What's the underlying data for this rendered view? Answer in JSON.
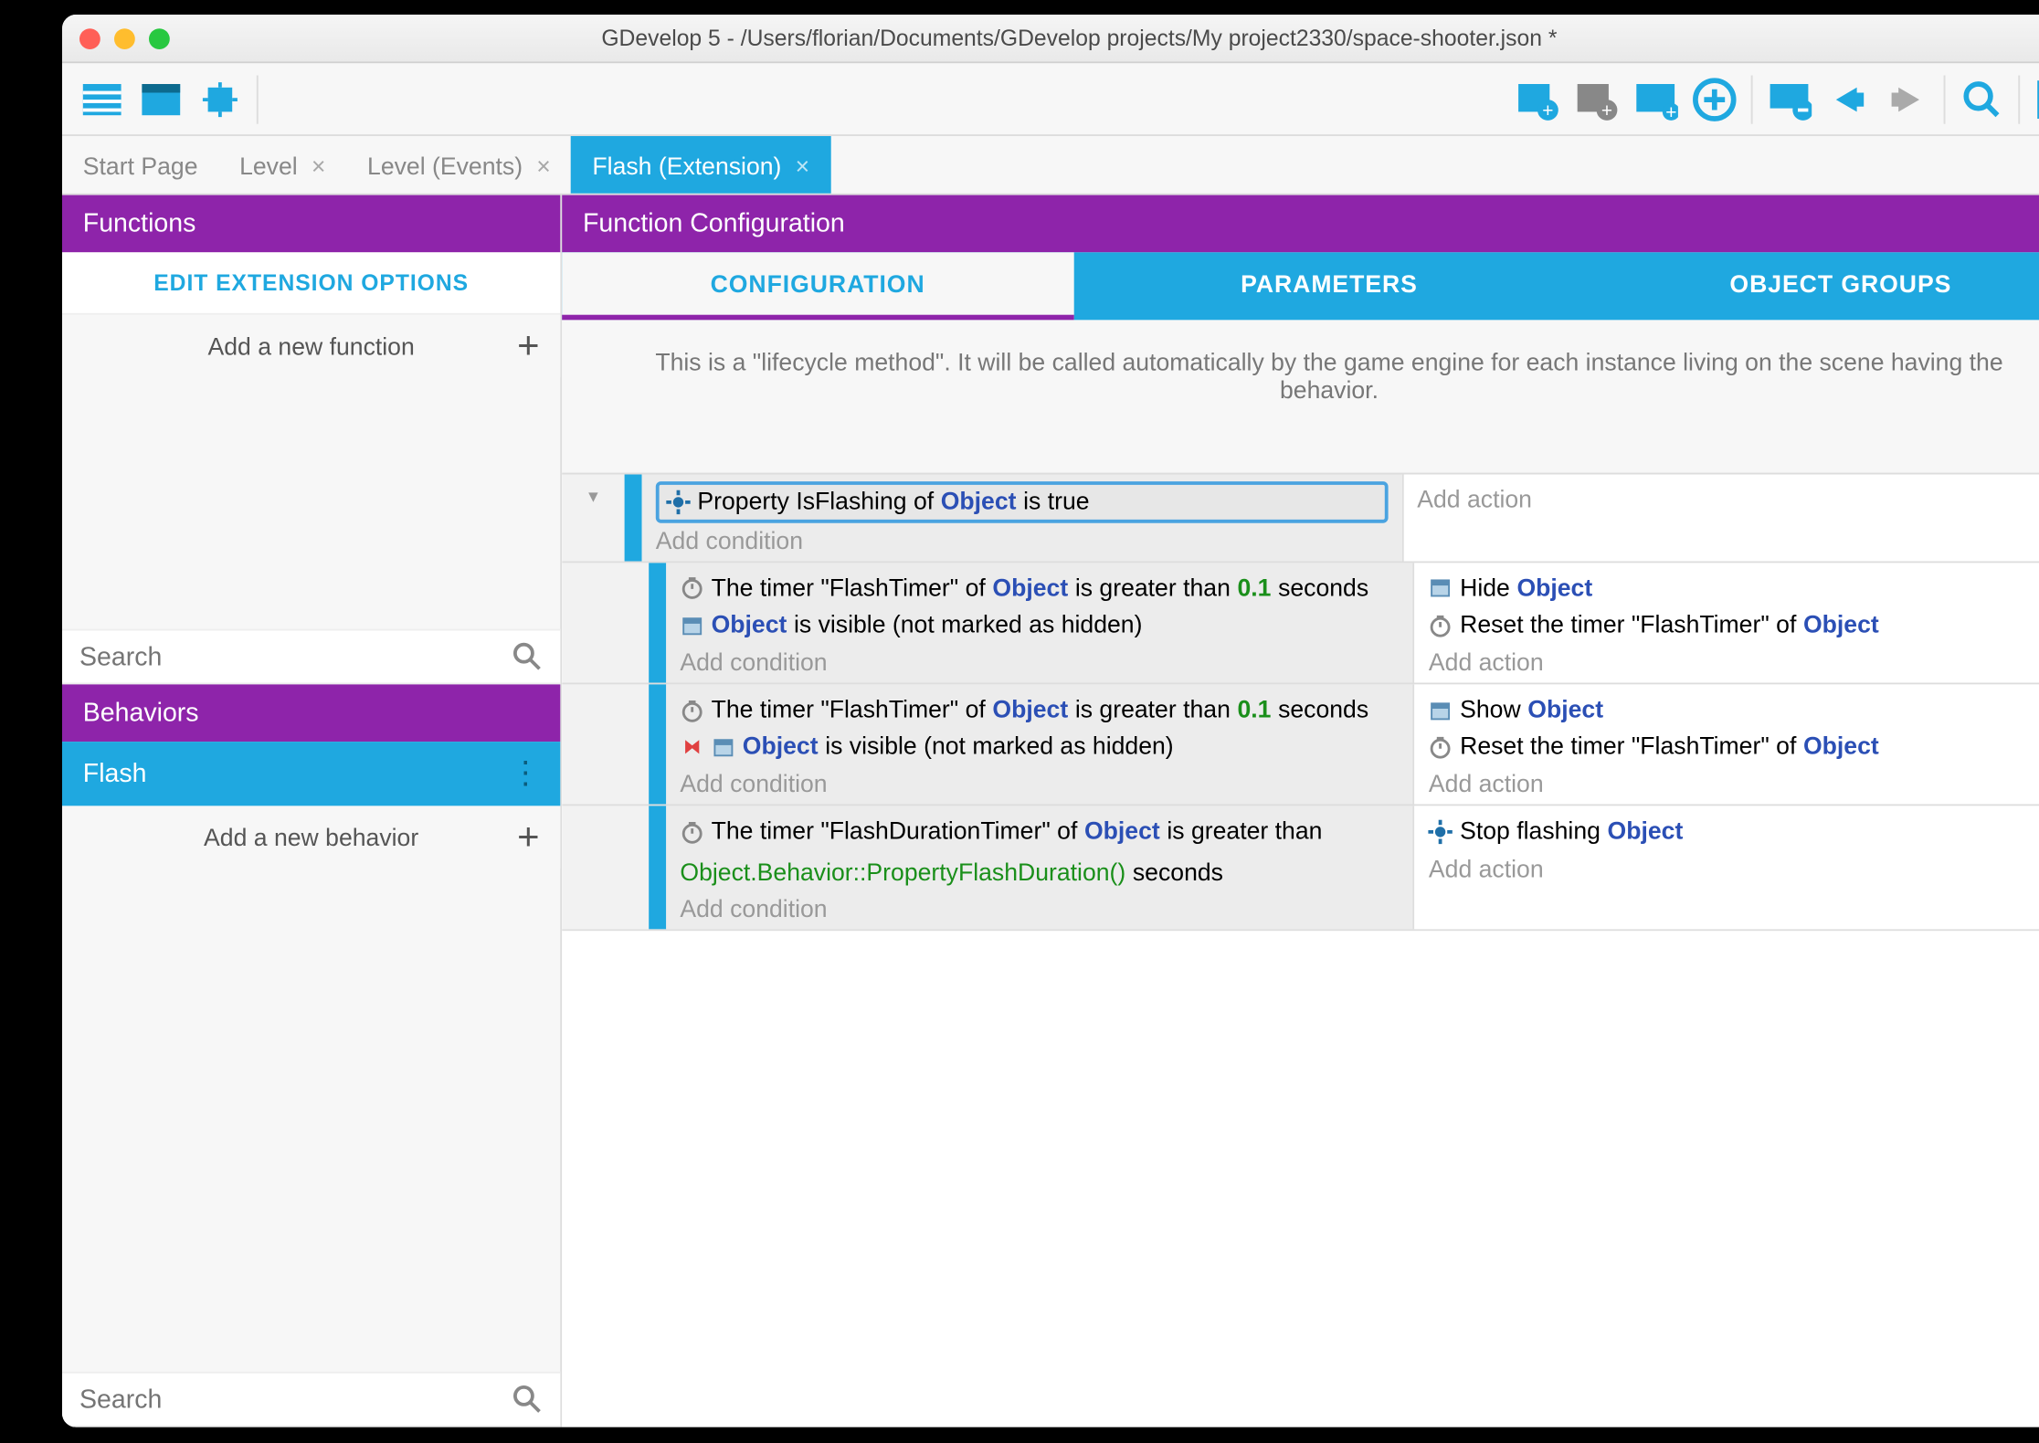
{
  "window_title": "GDevelop 5 - /Users/florian/Documents/GDevelop projects/My project2330/space-shooter.json *",
  "tabs": [
    {
      "label": "Start Page",
      "closable": false
    },
    {
      "label": "Level",
      "closable": true
    },
    {
      "label": "Level (Events)",
      "closable": true
    },
    {
      "label": "Flash (Extension)",
      "closable": true,
      "active": true
    }
  ],
  "sidebar": {
    "functions_header": "Functions",
    "edit_extension": "EDIT EXTENSION OPTIONS",
    "add_function": "Add a new function",
    "behaviors_header": "Behaviors",
    "behavior_item": "Flash",
    "add_behavior": "Add a new behavior",
    "search_placeholder": "Search"
  },
  "main": {
    "header": "Function Configuration",
    "subtabs": {
      "config": "CONFIGURATION",
      "params": "PARAMETERS",
      "groups": "OBJECT GROUPS"
    },
    "description": "This is a \"lifecycle method\". It will be called automatically by the game engine for each instance living on the scene having the behavior."
  },
  "labels": {
    "add_condition": "Add condition",
    "add_action": "Add action",
    "object": "Object",
    "is_true": "is true",
    "is_greater": "is greater than",
    "seconds": "seconds",
    "visible_suffix": "is visible (not marked as hidden)"
  },
  "events": [
    {
      "level": 0,
      "selected": true,
      "conditions": [
        {
          "icon": "gear",
          "parts": [
            {
              "t": "Property IsFlashing of "
            },
            {
              "t": "Object",
              "cls": "obj"
            },
            {
              "t": " is true"
            }
          ]
        }
      ],
      "actions": []
    },
    {
      "level": 1,
      "conditions": [
        {
          "icon": "timer",
          "parts": [
            {
              "t": "The timer \"FlashTimer\" of "
            },
            {
              "t": "Object",
              "cls": "obj"
            },
            {
              "t": " is greater than "
            },
            {
              "t": "0.1",
              "cls": "num"
            },
            {
              "t": " seconds"
            }
          ]
        },
        {
          "icon": "layer",
          "parts": [
            {
              "t": "Object",
              "cls": "obj"
            },
            {
              "t": " is visible (not marked as hidden)"
            }
          ]
        }
      ],
      "actions": [
        {
          "icon": "layer",
          "parts": [
            {
              "t": "Hide "
            },
            {
              "t": "Object",
              "cls": "obj"
            }
          ]
        },
        {
          "icon": "timer",
          "parts": [
            {
              "t": "Reset the timer \"FlashTimer\" of "
            },
            {
              "t": "Object",
              "cls": "obj"
            }
          ]
        }
      ]
    },
    {
      "level": 1,
      "conditions": [
        {
          "icon": "timer",
          "parts": [
            {
              "t": "The timer \"FlashTimer\" of "
            },
            {
              "t": "Object",
              "cls": "obj"
            },
            {
              "t": " is greater than "
            },
            {
              "t": "0.1",
              "cls": "num"
            },
            {
              "t": " seconds"
            }
          ]
        },
        {
          "icon": "invert",
          "second": "layer",
          "parts": [
            {
              "t": "Object",
              "cls": "obj"
            },
            {
              "t": " is visible (not marked as hidden)"
            }
          ]
        }
      ],
      "actions": [
        {
          "icon": "layer",
          "parts": [
            {
              "t": "Show "
            },
            {
              "t": "Object",
              "cls": "obj"
            }
          ]
        },
        {
          "icon": "timer",
          "parts": [
            {
              "t": "Reset the timer \"FlashTimer\" of "
            },
            {
              "t": "Object",
              "cls": "obj"
            }
          ]
        }
      ]
    },
    {
      "level": 1,
      "conditions": [
        {
          "icon": "timer",
          "parts": [
            {
              "t": "The timer \"FlashDurationTimer\" of "
            },
            {
              "t": "Object",
              "cls": "obj"
            },
            {
              "t": " is greater than "
            },
            {
              "t": "Object.Behavior::PropertyFlashDuration()",
              "cls": "expr"
            },
            {
              "t": " seconds"
            }
          ]
        }
      ],
      "actions": [
        {
          "icon": "gear",
          "parts": [
            {
              "t": "Stop flashing "
            },
            {
              "t": "Object",
              "cls": "obj"
            }
          ]
        }
      ]
    }
  ]
}
